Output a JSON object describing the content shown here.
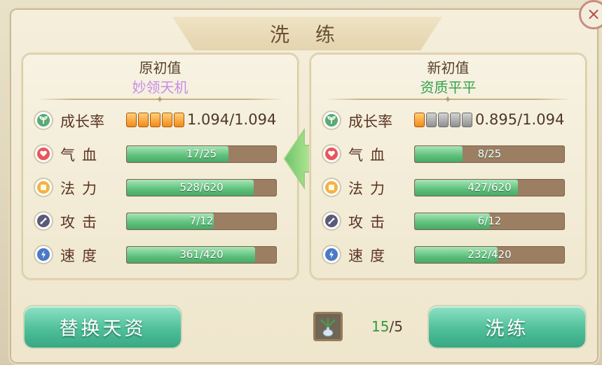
{
  "dialog": {
    "title": "洗 练",
    "close_label": "×"
  },
  "left_panel": {
    "header": "原初值",
    "quality": "妙领天机",
    "growth": {
      "label": "成长率",
      "value": "1.094/1.094",
      "gems": [
        "on",
        "on",
        "on",
        "on",
        "on"
      ]
    },
    "stats": [
      {
        "label": "气血",
        "value": "17/25",
        "ratio": 0.68,
        "icon": "heart-icon",
        "icon_color": "#e8565b"
      },
      {
        "label": "法力",
        "value": "528/620",
        "ratio": 0.8516,
        "icon": "square-icon",
        "icon_color": "#f0b447"
      },
      {
        "label": "攻击",
        "value": "7/12",
        "ratio": 0.5833,
        "icon": "sword-icon",
        "icon_color": "#5b5a7a"
      },
      {
        "label": "速度",
        "value": "361/420",
        "ratio": 0.8595,
        "icon": "lightning-icon",
        "icon_color": "#4b79c4"
      }
    ]
  },
  "right_panel": {
    "header": "新初值",
    "quality": "资质平平",
    "growth": {
      "label": "成长率",
      "value": "0.895/1.094",
      "gems": [
        "on",
        "off",
        "off",
        "off",
        "off"
      ]
    },
    "stats": [
      {
        "label": "气血",
        "value": "8/25",
        "ratio": 0.32,
        "icon": "heart-icon",
        "icon_color": "#e8565b"
      },
      {
        "label": "法力",
        "value": "427/620",
        "ratio": 0.6887,
        "icon": "square-icon",
        "icon_color": "#f0b447"
      },
      {
        "label": "攻击",
        "value": "6/12",
        "ratio": 0.5,
        "icon": "sword-icon",
        "icon_color": "#5b5a7a"
      },
      {
        "label": "速度",
        "value": "232/420",
        "ratio": 0.5524,
        "icon": "lightning-icon",
        "icon_color": "#4b79c4"
      }
    ]
  },
  "buttons": {
    "replace": "替换天资",
    "refine": "洗练"
  },
  "counter": {
    "current": "15",
    "total": "/5"
  },
  "colors": {
    "growth_icon": "#5aaa73",
    "accent_green": "#4fc09a",
    "bar_track": "#9c7e63"
  }
}
